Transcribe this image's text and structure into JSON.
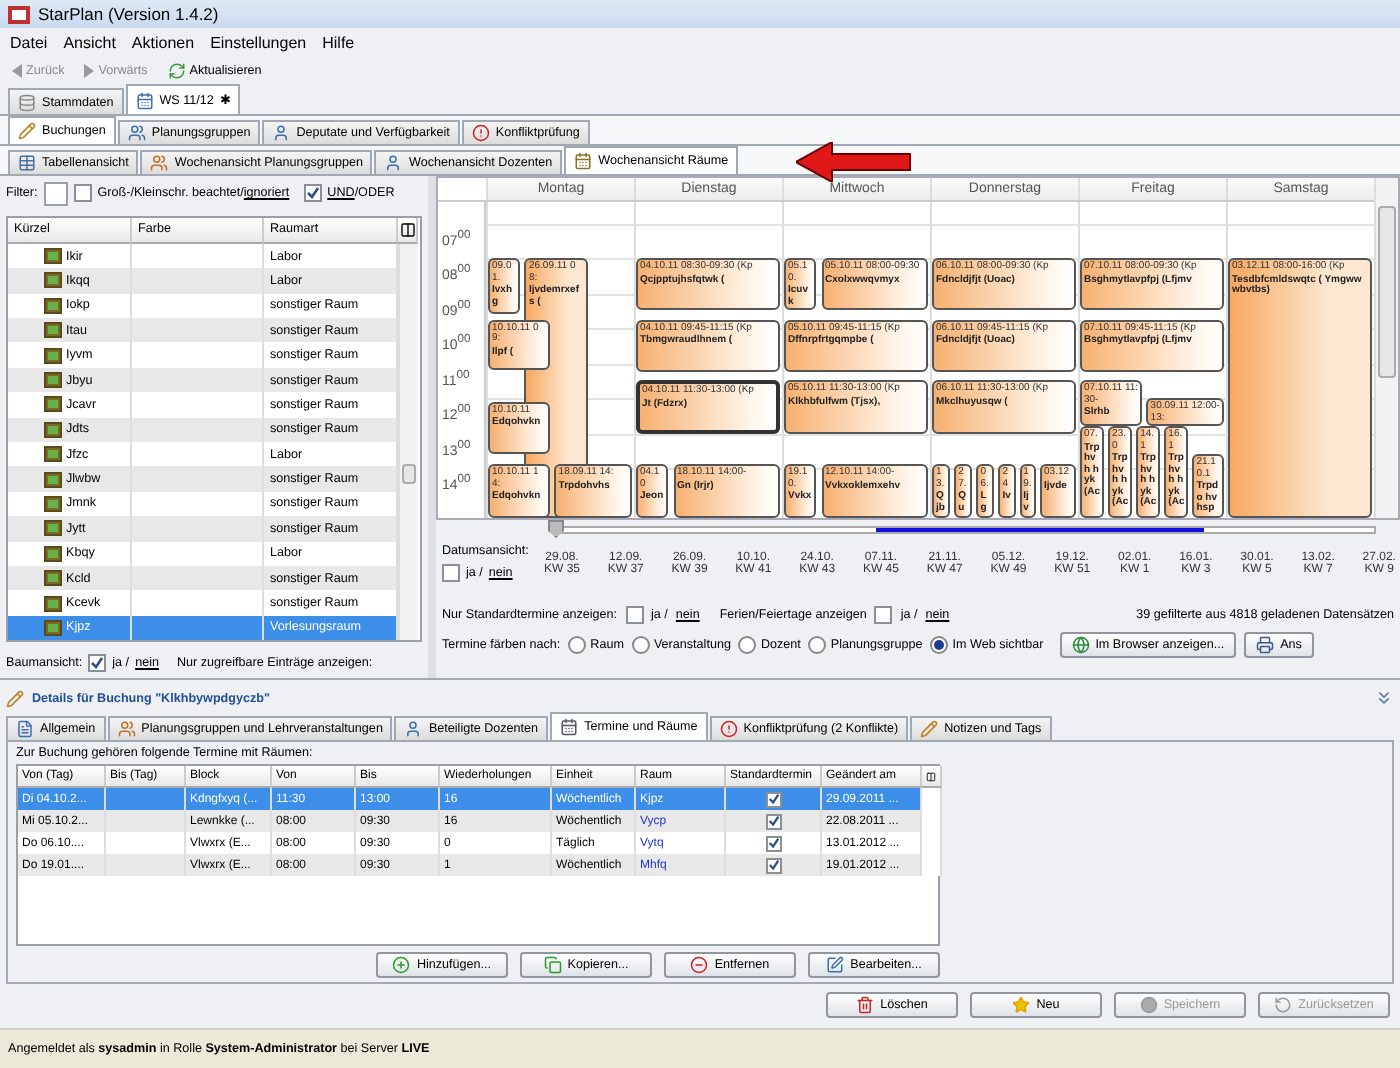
{
  "window": {
    "title": "StarPlan (Version 1.4.2)"
  },
  "menu": [
    {
      "label": "Datei"
    },
    {
      "label": "Ansicht"
    },
    {
      "label": "Aktionen"
    },
    {
      "label": "Einstellungen"
    },
    {
      "label": "Hilfe"
    }
  ],
  "toolbar": [
    {
      "label": "Zurück",
      "disabled": true
    },
    {
      "label": "Vorwärts",
      "disabled": true
    },
    {
      "label": "Aktualisieren",
      "disabled": false
    }
  ],
  "doc_tabs": [
    {
      "label": "Stammdaten",
      "selected": false
    },
    {
      "label": "WS 11/12",
      "selected": true,
      "mark": "✱"
    }
  ],
  "main_tabs": [
    {
      "label": "Buchungen",
      "selected": true
    },
    {
      "label": "Planungsgruppen",
      "selected": false
    },
    {
      "label": "Deputate und Verfügbarkeit",
      "selected": false
    },
    {
      "label": "Konfliktprüfung",
      "selected": false
    }
  ],
  "view_tabs": [
    {
      "label": "Tabellenansicht",
      "selected": false
    },
    {
      "label": "Wochenansicht Planungsgruppen",
      "selected": false
    },
    {
      "label": "Wochenansicht Dozenten",
      "selected": false
    },
    {
      "label": "Wochenansicht Räume",
      "selected": true
    }
  ],
  "filter": {
    "label": "Filter:",
    "case_checked": false,
    "case_label": "Groß-/Kleinschr. beachtet/",
    "case_link": "ignoriert",
    "and_checked": true,
    "and_link": "UND",
    "and_rest": "/ODER"
  },
  "room_table": {
    "columns": [
      "Kürzel",
      "Farbe",
      "Raumart"
    ],
    "rows": [
      {
        "code": "Ikir",
        "type": "Labor",
        "selected": false
      },
      {
        "code": "Ikqq",
        "type": "Labor",
        "selected": false
      },
      {
        "code": "Iokp",
        "type": "sonstiger Raum",
        "selected": false
      },
      {
        "code": "Itau",
        "type": "sonstiger Raum",
        "selected": false
      },
      {
        "code": "Iyvm",
        "type": "sonstiger Raum",
        "selected": false
      },
      {
        "code": "Jbyu",
        "type": "sonstiger Raum",
        "selected": false
      },
      {
        "code": "Jcavr",
        "type": "sonstiger Raum",
        "selected": false
      },
      {
        "code": "Jdts",
        "type": "sonstiger Raum",
        "selected": false
      },
      {
        "code": "Jfzc",
        "type": "Labor",
        "selected": false
      },
      {
        "code": "Jlwbw",
        "type": "sonstiger Raum",
        "selected": false
      },
      {
        "code": "Jmnk",
        "type": "sonstiger Raum",
        "selected": false
      },
      {
        "code": "Jytt",
        "type": "sonstiger Raum",
        "selected": false
      },
      {
        "code": "Kbqy",
        "type": "Labor",
        "selected": false
      },
      {
        "code": "Kcld",
        "type": "sonstiger Raum",
        "selected": false
      },
      {
        "code": "Kcevk",
        "type": "sonstiger Raum",
        "selected": false
      },
      {
        "code": "Kjpz",
        "type": "Vorlesungsraum",
        "selected": true
      }
    ]
  },
  "tree_view": {
    "label": "Baumansicht:",
    "checked": true,
    "yes": "ja /",
    "no": "nein"
  },
  "accessible_only": {
    "label": "Nur zugreifbare Einträge anzeigen:"
  },
  "calendar": {
    "days": [
      "Montag",
      "Dienstag",
      "Mittwoch",
      "Donnerstag",
      "Freitag",
      "Samstag"
    ],
    "hours": [
      "07$^{00}$",
      "08$^{00}$",
      "09$^{00}$",
      "10$^{00}$",
      "11$^{00}$",
      "12$^{00}$",
      "13$^{00}$",
      "14$^{00}$"
    ],
    "events": [
      {
        "time": "09.01.",
        "title": "Ivxhg",
        "selected": false
      },
      {
        "time": "26.09.11 08:",
        "title": "Ijvdemrxefs (",
        "selected": false
      },
      {
        "time": "10.10.11 09:",
        "title": "Ilpf (",
        "selected": false
      },
      {
        "time": "10.10.11",
        "title": "Edqohvkn",
        "selected": false
      },
      {
        "time": "10.10.11 14:",
        "title": "Edqohvkn",
        "selected": false
      },
      {
        "time": "18.09.11 14:",
        "title": "Trpdohvhs",
        "selected": false
      },
      {
        "time": "04.10.11 08:30-09:30 (Kp",
        "title": "Qcjpptujhsfqtwk (",
        "selected": false
      },
      {
        "time": "04.10.11 09:45-11:15 (Kp",
        "title": "Tbmgwraudlhnem (",
        "selected": false
      },
      {
        "time": "04.10.11 11:30-13:00 (Kp",
        "title": "Jt (Fdzrx)",
        "selected": true
      },
      {
        "time": "04.10",
        "title": "Jeon",
        "selected": false
      },
      {
        "time": "18.10.11 14:00-",
        "title": "Gn (Irjr)",
        "selected": false
      },
      {
        "time": "05.10.",
        "title": "Icuvk",
        "selected": false
      },
      {
        "time": "05.10.11 08:00-09:30",
        "title": "Cxolxwwqvmyx",
        "selected": false
      },
      {
        "time": "05.10.11 09:45-11:15 (Kp",
        "title": "Dffnrpfrtgqmpbe (",
        "selected": false
      },
      {
        "time": "05.10.11 11:30-13:00 (Kp",
        "title": "Klkhbfulfwm (Tjsx),",
        "selected": false
      },
      {
        "time": "19.10.",
        "title": "Vvkx",
        "selected": false
      },
      {
        "time": "12.10.11 14:00-",
        "title": "Vvkxoklemxehv",
        "selected": false
      },
      {
        "time": "06.10.11 08:00-09:30 (Kp",
        "title": "Fdncldjfjt (Uoac)",
        "selected": false
      },
      {
        "time": "06.10.11 09:45-11:15 (Kp",
        "title": "Fdncldjfjt (Uoac)",
        "selected": false
      },
      {
        "time": "06.10.11 11:30-13:00 (Kp",
        "title": "Mkclhuyusqw (",
        "selected": false
      },
      {
        "time": "13.",
        "title": "Qjb",
        "selected": false
      },
      {
        "time": "27.",
        "title": "Qu",
        "selected": false
      },
      {
        "time": "06.",
        "title": "Lg",
        "selected": false
      },
      {
        "time": "24",
        "title": "Iv",
        "selected": false
      },
      {
        "time": "19.",
        "title": "Ijv",
        "selected": false
      },
      {
        "time": "03.12",
        "title": "Ijvde",
        "selected": false
      },
      {
        "time": "07.10.11 08:00-09:30 (Kp",
        "title": "Bsghmytlavpfpj (Lfjmv",
        "selected": false
      },
      {
        "time": "07.10.11 09:45-11:15 (Kp",
        "title": "Bsghmytlavpfpj (Lfjmv",
        "selected": false
      },
      {
        "time": "07.10.11 11:30-",
        "title": "Slrhb",
        "selected": false
      },
      {
        "time": "30.09.11 12:00-13:",
        "selected": false
      },
      {
        "time": "07.",
        "title": "Trp hvh hyk (Ac",
        "selected": false
      },
      {
        "time": "23.0",
        "title": "Trp hvh hyk (Ac",
        "selected": false
      },
      {
        "time": "14.1",
        "title": "Trp hvh hyk (Ac",
        "selected": false
      },
      {
        "time": "16.1",
        "title": "Trp hvh hyk (Ac",
        "selected": false
      },
      {
        "time": "21.10.1",
        "title": "Trpdo hvhsp",
        "selected": false
      },
      {
        "time": "03.12.11 08:00-16:00 (Kp",
        "title": "Tesdbfcmldswqtc ( Ymgwwwbvtbs)",
        "selected": false
      }
    ]
  },
  "date_view": {
    "label": "Datumsansicht:",
    "checked": false,
    "yes": "ja /",
    "no": "nein",
    "level": 0,
    "ticks": [
      {
        "date": "29.08.",
        "week": "KW 35"
      },
      {
        "date": "12.09.",
        "week": "KW 37"
      },
      {
        "date": "26.09.",
        "week": "KW 39"
      },
      {
        "date": "10.10.",
        "week": "KW 41"
      },
      {
        "date": "24.10.",
        "week": "KW 43"
      },
      {
        "date": "07.11.",
        "week": "KW 45"
      },
      {
        "date": "21.11.",
        "week": "KW 47"
      },
      {
        "date": "05.12.",
        "week": "KW 49"
      },
      {
        "date": "19.12.",
        "week": "KW 51"
      },
      {
        "date": "02.01.",
        "week": "KW 1"
      },
      {
        "date": "16.01.",
        "week": "KW 3"
      },
      {
        "date": "30.01.",
        "week": "KW 5"
      },
      {
        "date": "13.02.",
        "week": "KW 7"
      },
      {
        "date": "27.02.",
        "week": "KW 9"
      }
    ]
  },
  "options": {
    "standard_label": "Nur Standardtermine anzeigen:",
    "standard_checked": false,
    "standard_yes": "ja /",
    "standard_no": "nein",
    "holidays_label": "Ferien/Feiertage anzeigen",
    "holidays_checked": false,
    "holidays_yes": "ja /",
    "holidays_no": "nein",
    "count": "39 gefilterte aus 4818 geladenen Datensätzen"
  },
  "color_by": {
    "label": "Termine färben nach:",
    "options": [
      {
        "label": "Raum",
        "selected": false
      },
      {
        "label": "Veranstaltung",
        "selected": false
      },
      {
        "label": "Dozent",
        "selected": false
      },
      {
        "label": "Planungsgruppe",
        "selected": false
      },
      {
        "label": "Im Web sichtbar",
        "selected": true
      }
    ],
    "buttons": [
      "Im Browser anzeigen...",
      "Ans"
    ]
  },
  "details": {
    "title": "Details für Buchung \"Klkhbywpdgyczb\"",
    "tabs": [
      {
        "label": "Allgemein",
        "selected": false
      },
      {
        "label": "Planungsgruppen und Lehrveranstaltungen",
        "selected": false
      },
      {
        "label": "Beteiligte Dozenten",
        "selected": false
      },
      {
        "label": "Termine und Räume",
        "selected": true
      },
      {
        "label": "Konfliktprüfung (2 Konflikte)",
        "selected": false
      },
      {
        "label": "Notizen und Tags",
        "selected": false
      }
    ],
    "caption": "Zur Buchung gehören folgende Termine mit Räumen:",
    "table": {
      "columns": [
        "Von (Tag)",
        "Bis (Tag)",
        "Block",
        "Von",
        "Bis",
        "Wiederholungen",
        "Einheit",
        "Raum",
        "Standardtermin",
        "Geändert am"
      ],
      "rows": [
        {
          "from_day": "Di 04.10.2...",
          "block": "Kdngfxyq (...",
          "from": "11:30",
          "to": "13:00",
          "repeats": "16",
          "unit": "Wöchentlich",
          "room": "Kjpz",
          "standard": true,
          "changed": "29.09.2011 ...",
          "selected": true
        },
        {
          "from_day": "Mi 05.10.2...",
          "block": "Lewnkke (...",
          "from": "08:00",
          "to": "09:30",
          "repeats": "16",
          "unit": "Wöchentlich",
          "room": "Vycp",
          "standard": true,
          "changed": "22.08.2011 ...",
          "selected": false
        },
        {
          "from_day": "Do 06.10....",
          "block": "Vlwxrx (E...",
          "from": "08:00",
          "to": "09:30",
          "repeats": "0",
          "unit": "Täglich",
          "room": "Vytq",
          "standard": true,
          "changed": "13.01.2012 ...",
          "selected": false
        },
        {
          "from_day": "Do 19.01....",
          "block": "Vlwxrx (E...",
          "from": "08:00",
          "to": "09:30",
          "repeats": "1",
          "unit": "Wöchentlich",
          "room": "Mhfq",
          "standard": true,
          "changed": "19.01.2012 ...",
          "selected": false
        }
      ]
    },
    "buttons": [
      "Hinzufügen...",
      "Kopieren...",
      "Entfernen",
      "Bearbeiten..."
    ]
  },
  "actions": [
    {
      "label": "Löschen",
      "disabled": false
    },
    {
      "label": "Neu",
      "disabled": false
    },
    {
      "label": "Speichern",
      "disabled": true
    },
    {
      "label": "Zurücksetzen",
      "disabled": true
    }
  ],
  "status_bar": "Angemeldet als **sysadmin** in Rolle **System-Administrator** bei Server **LIVE**"
}
